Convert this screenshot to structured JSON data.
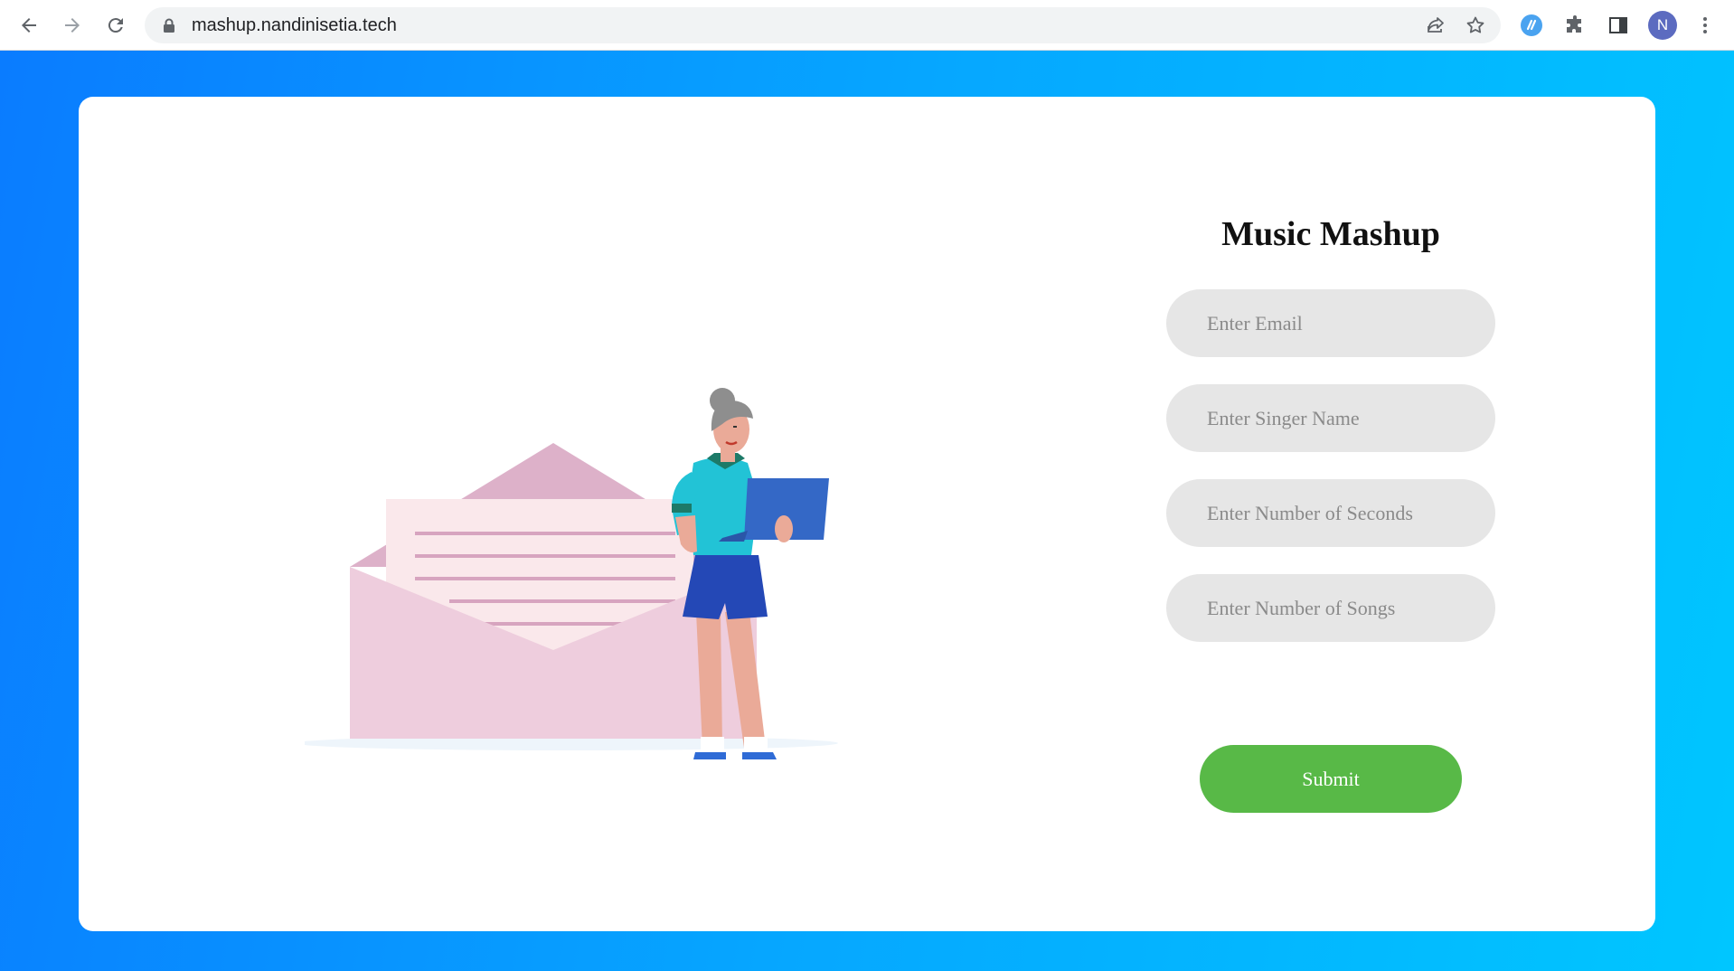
{
  "browser": {
    "url": "mashup.nandinisetia.tech",
    "profile_initial": "N",
    "icons": [
      "back-icon",
      "forward-icon",
      "reload-icon",
      "lock-icon",
      "share-icon",
      "star-icon",
      "extension-icon",
      "puzzle-icon",
      "side-panel-icon",
      "more-icon"
    ]
  },
  "page": {
    "title": "Music Mashup",
    "fields": {
      "email_placeholder": "Enter Email",
      "singer_placeholder": "Enter Singer Name",
      "seconds_placeholder": "Enter Number of Seconds",
      "songs_placeholder": "Enter Number of Songs"
    },
    "submit_label": "Submit"
  },
  "colors": {
    "background_gradient": [
      "#0a7cff",
      "#00c6ff"
    ],
    "card": "#ffffff",
    "field": "#e6e6e6",
    "submit": "#58b947"
  }
}
